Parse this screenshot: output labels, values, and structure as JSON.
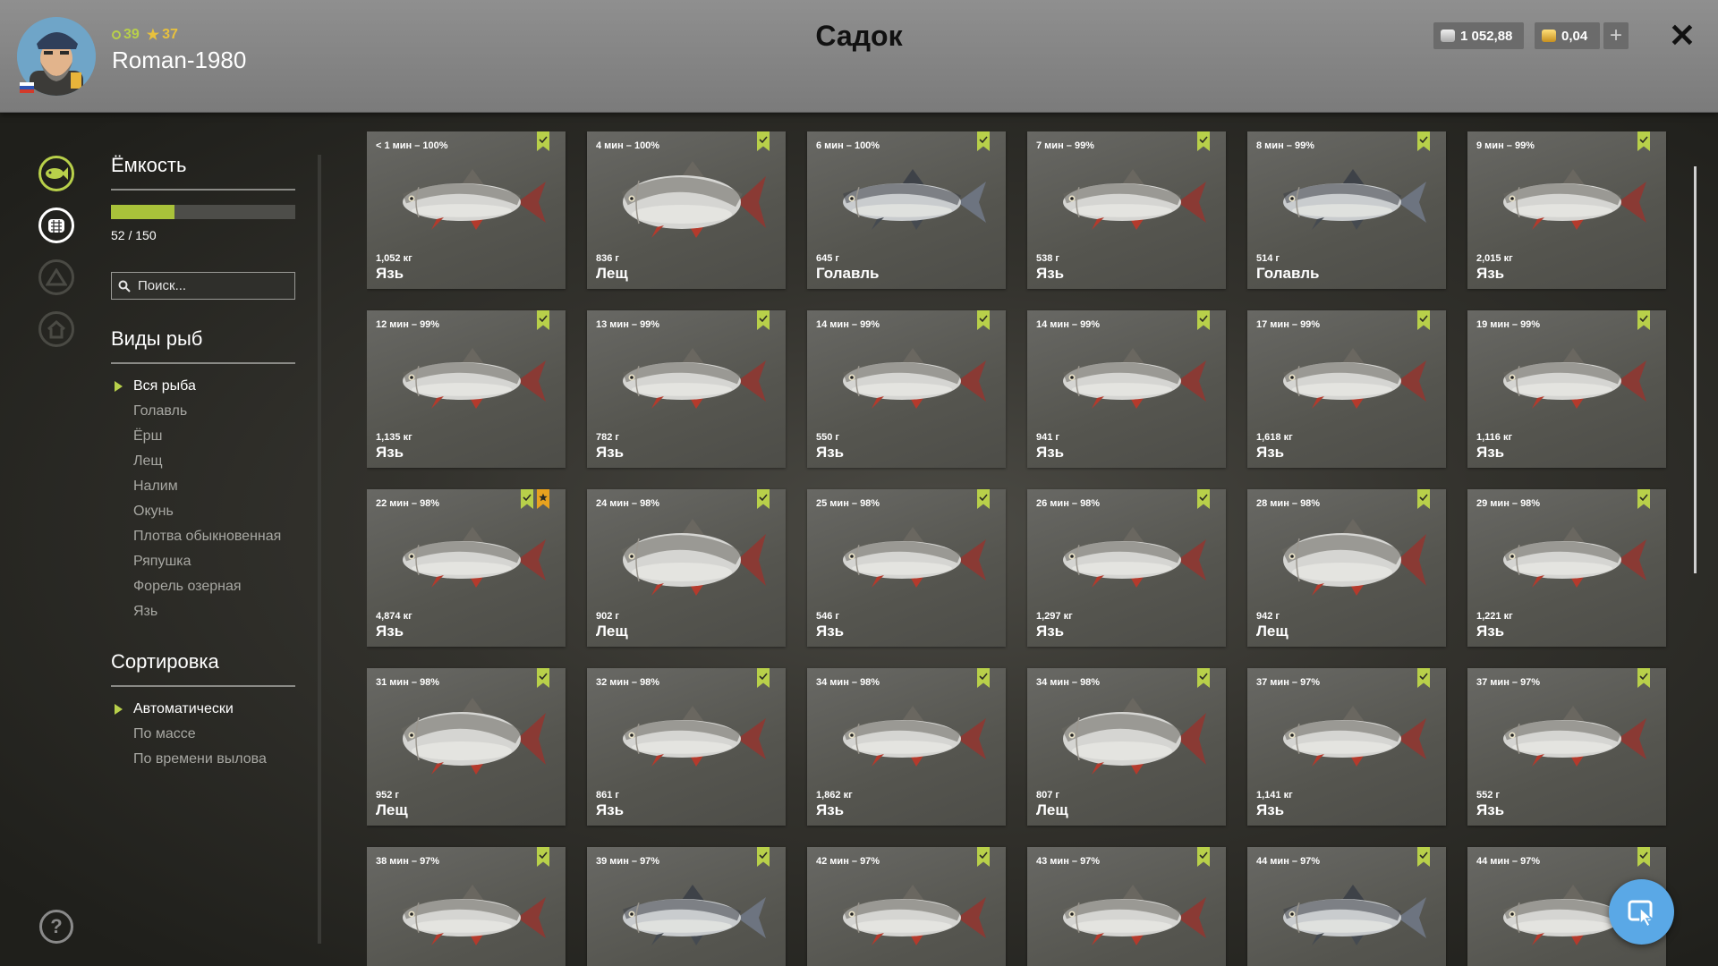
{
  "player": {
    "name": "Roman-1980",
    "level": "39",
    "rank": "37"
  },
  "header": {
    "title": "Садок",
    "silver": "1 052,88",
    "gold": "0,04",
    "add_label": "+",
    "close_label": "✕"
  },
  "capacity": {
    "title": "Ёмкость",
    "used": 52,
    "max": 150,
    "text": "52 / 150"
  },
  "search": {
    "placeholder": "Поиск..."
  },
  "species": {
    "title": "Виды рыб",
    "items": [
      "Вся рыба",
      "Голавль",
      "Ёрш",
      "Лещ",
      "Налим",
      "Окунь",
      "Плотва обыкновенная",
      "Ряпушка",
      "Форель озерная",
      "Язь"
    ],
    "active": 0
  },
  "sorting": {
    "title": "Сортировка",
    "items": [
      "Автоматически",
      "По массе",
      "По времени вылова"
    ],
    "active": 0
  },
  "help_label": "?",
  "colors": {
    "accent": "#b8d04a",
    "card_bg": "#5a5a55",
    "fab": "#5aa8e6"
  },
  "fish": [
    {
      "time": "< 1 мин – 100%",
      "weight": "1,052 кг",
      "name": "Язь",
      "kind": "ide"
    },
    {
      "time": "4 мин – 100%",
      "weight": "836 г",
      "name": "Лещ",
      "kind": "bream"
    },
    {
      "time": "6 мин – 100%",
      "weight": "645 г",
      "name": "Голавль",
      "kind": "chub"
    },
    {
      "time": "7 мин – 99%",
      "weight": "538 г",
      "name": "Язь",
      "kind": "ide"
    },
    {
      "time": "8 мин – 99%",
      "weight": "514 г",
      "name": "Голавль",
      "kind": "chub"
    },
    {
      "time": "9 мин – 99%",
      "weight": "2,015 кг",
      "name": "Язь",
      "kind": "ide"
    },
    {
      "time": "12 мин – 99%",
      "weight": "1,135 кг",
      "name": "Язь",
      "kind": "ide"
    },
    {
      "time": "13 мин – 99%",
      "weight": "782 г",
      "name": "Язь",
      "kind": "ide"
    },
    {
      "time": "14 мин – 99%",
      "weight": "550 г",
      "name": "Язь",
      "kind": "ide"
    },
    {
      "time": "14 мин – 99%",
      "weight": "941 г",
      "name": "Язь",
      "kind": "ide"
    },
    {
      "time": "17 мин – 99%",
      "weight": "1,618 кг",
      "name": "Язь",
      "kind": "ide"
    },
    {
      "time": "19 мин – 99%",
      "weight": "1,116 кг",
      "name": "Язь",
      "kind": "ide"
    },
    {
      "time": "22 мин – 98%",
      "weight": "4,874 кг",
      "name": "Язь",
      "kind": "ide",
      "trophy": true
    },
    {
      "time": "24 мин – 98%",
      "weight": "902 г",
      "name": "Лещ",
      "kind": "bream"
    },
    {
      "time": "25 мин – 98%",
      "weight": "546 г",
      "name": "Язь",
      "kind": "ide"
    },
    {
      "time": "26 мин – 98%",
      "weight": "1,297 кг",
      "name": "Язь",
      "kind": "ide"
    },
    {
      "time": "28 мин – 98%",
      "weight": "942 г",
      "name": "Лещ",
      "kind": "bream"
    },
    {
      "time": "29 мин – 98%",
      "weight": "1,221 кг",
      "name": "Язь",
      "kind": "ide"
    },
    {
      "time": "31 мин – 98%",
      "weight": "952 г",
      "name": "Лещ",
      "kind": "bream"
    },
    {
      "time": "32 мин – 98%",
      "weight": "861 г",
      "name": "Язь",
      "kind": "ide"
    },
    {
      "time": "34 мин – 98%",
      "weight": "1,862 кг",
      "name": "Язь",
      "kind": "ide"
    },
    {
      "time": "34 мин – 98%",
      "weight": "807 г",
      "name": "Лещ",
      "kind": "bream"
    },
    {
      "time": "37 мин – 97%",
      "weight": "1,141 кг",
      "name": "Язь",
      "kind": "ide"
    },
    {
      "time": "37 мин – 97%",
      "weight": "552 г",
      "name": "Язь",
      "kind": "ide"
    },
    {
      "time": "38 мин – 97%",
      "weight": "",
      "name": "",
      "kind": "ide"
    },
    {
      "time": "39 мин – 97%",
      "weight": "",
      "name": "",
      "kind": "chub"
    },
    {
      "time": "42 мин – 97%",
      "weight": "",
      "name": "",
      "kind": "ide"
    },
    {
      "time": "43 мин – 97%",
      "weight": "",
      "name": "",
      "kind": "ide"
    },
    {
      "time": "44 мин – 97%",
      "weight": "",
      "name": "",
      "kind": "chub"
    },
    {
      "time": "44 мин – 97%",
      "weight": "",
      "name": "",
      "kind": "ide"
    }
  ]
}
